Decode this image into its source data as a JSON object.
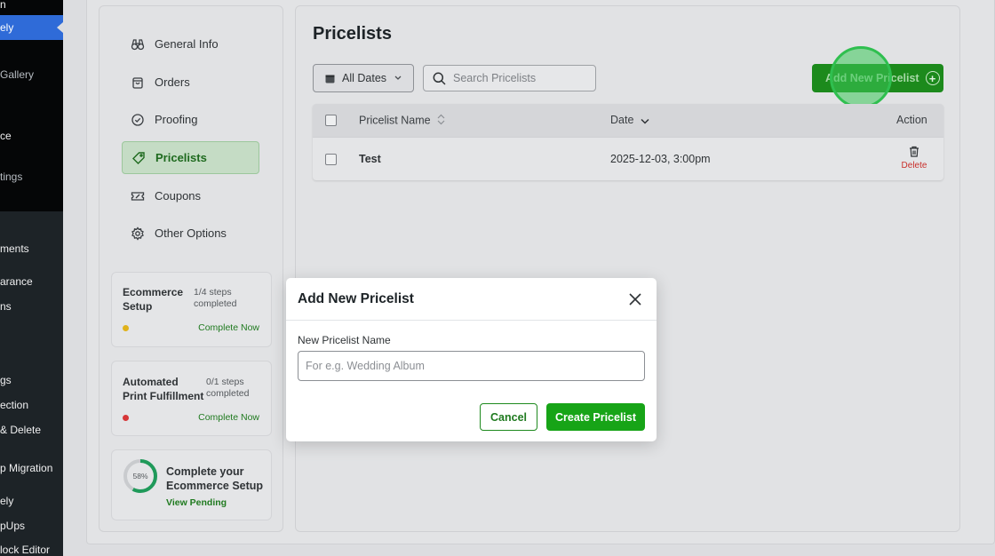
{
  "wp_menu": {
    "items": [
      {
        "label": "n"
      },
      {
        "label": "ely"
      },
      {
        "label": "Gallery"
      },
      {
        "label": "ce"
      },
      {
        "label": "tings"
      },
      {
        "label": "ments"
      },
      {
        "label": "arance"
      },
      {
        "label": "ns"
      },
      {
        "label": "gs"
      },
      {
        "label": "ection"
      },
      {
        "label": "& Delete"
      },
      {
        "label": "p Migration"
      },
      {
        "label": "ely"
      },
      {
        "label": "pUps"
      },
      {
        "label": "lock Editor"
      }
    ]
  },
  "nav": {
    "items": [
      {
        "label": "General Info",
        "icon": "binoculars-icon"
      },
      {
        "label": "Orders",
        "icon": "shopping-bag-icon"
      },
      {
        "label": "Proofing",
        "icon": "check-circle-icon"
      },
      {
        "label": "Pricelists",
        "icon": "tag-icon",
        "active": true
      },
      {
        "label": "Coupons",
        "icon": "ticket-icon"
      },
      {
        "label": "Other Options",
        "icon": "gear-icon"
      }
    ]
  },
  "setup_cards": [
    {
      "title": "Ecommerce Setup",
      "steps": "1/4 steps completed",
      "link": "Complete Now",
      "dot_color": "#e0b21b"
    },
    {
      "title": "Automated Print Fulfillment",
      "steps": "0/1 steps completed",
      "link": "Complete Now",
      "dot_color": "#d63638"
    }
  ],
  "progress_card": {
    "percent_label": "58%",
    "percent": 58,
    "title": "Complete your Ecommerce Setup",
    "link": "View Pending"
  },
  "main": {
    "title": "Pricelists",
    "dates_filter": "All Dates",
    "search_placeholder": "Search Pricelists",
    "add_button": "Add New Pricelist",
    "table": {
      "columns": {
        "name": "Pricelist Name",
        "date": "Date",
        "action": "Action"
      },
      "rows": [
        {
          "name": "Test",
          "date": "2025-12-03, 3:00pm",
          "action": "Delete"
        }
      ]
    }
  },
  "modal": {
    "title": "Add New Pricelist",
    "field_label": "New Pricelist Name",
    "field_placeholder": "For e.g. Wedding Album",
    "field_value": "",
    "cancel": "Cancel",
    "create": "Create Pricelist"
  },
  "colors": {
    "brand_green": "#17a417",
    "active_nav_bg": "#c5dcc5",
    "delete_red": "#c9302c",
    "wp_active_blue": "#2f6bd8"
  }
}
